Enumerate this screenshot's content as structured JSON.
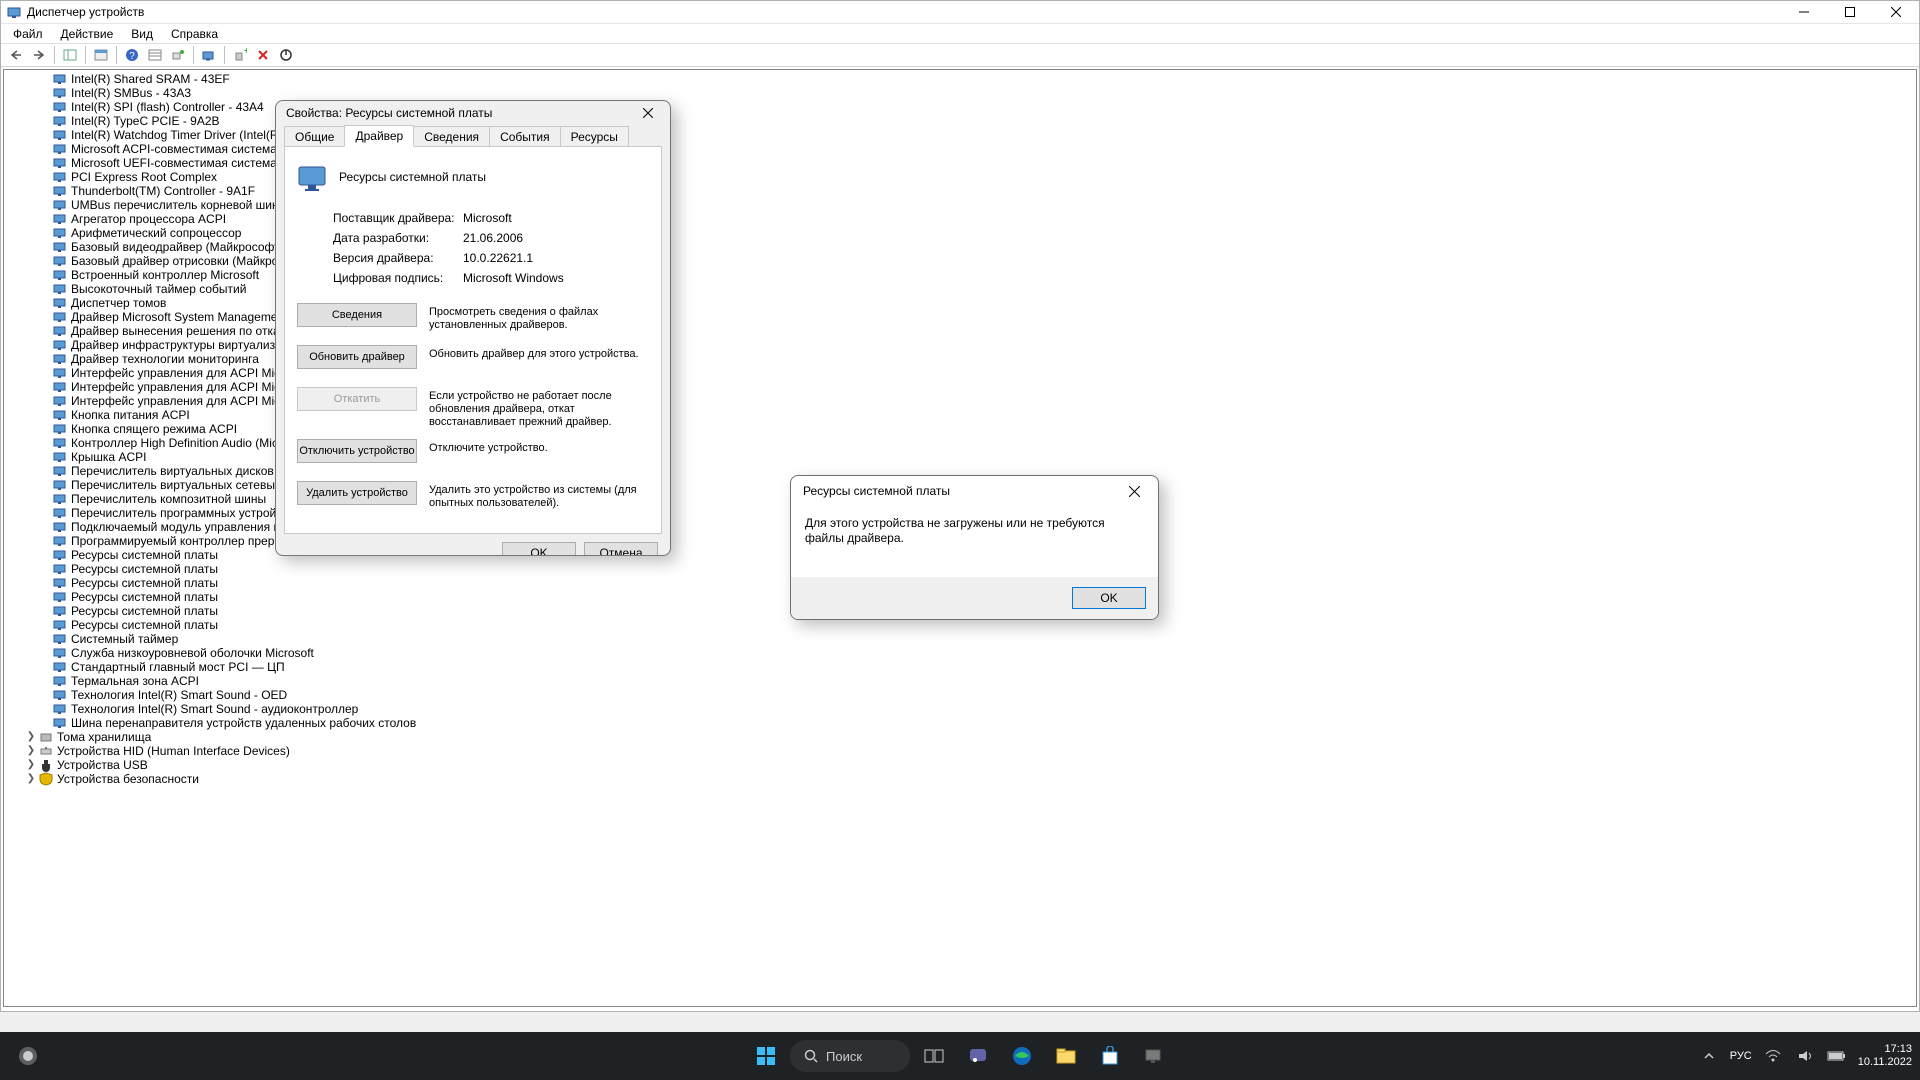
{
  "window": {
    "title": "Диспетчер устройств"
  },
  "menus": [
    "Файл",
    "Действие",
    "Вид",
    "Справка"
  ],
  "tree": {
    "devices": [
      "Intel(R) Shared SRAM - 43EF",
      "Intel(R) SMBus - 43A3",
      "Intel(R) SPI (flash) Controller - 43A4",
      "Intel(R) TypeC PCIE - 9A2B",
      "Intel(R) Watchdog Timer Driver (Intel(R) WDT)",
      "Microsoft ACPI-совместимая система",
      "Microsoft UEFI-совместимая система",
      "PCI Express Root Complex",
      "Thunderbolt(TM) Controller - 9A1F",
      "UMBus перечислитель корневой шины",
      "Агрегатор процессора ACPI",
      "Арифметический сопроцессор",
      "Базовый видеодрайвер (Майкрософт)",
      "Базовый драйвер отрисовки (Майкрософт)",
      "Встроенный контроллер Microsoft",
      "Высокоточный таймер событий",
      "Диспетчер томов",
      "Драйвер Microsoft System Management BIOS",
      "Драйвер вынесения решения по отказоустойчивости",
      "Драйвер инфраструктуры виртуализации",
      "Драйвер технологии мониторинга",
      "Интерфейс управления для ACPI Microsoft",
      "Интерфейс управления для ACPI Microsoft",
      "Интерфейс управления для ACPI Microsoft",
      "Кнопка питания ACPI",
      "Кнопка спящего режима ACPI",
      "Контроллер High Definition Audio (Microsoft)",
      "Крышка ACPI",
      "Перечислитель виртуальных дисков (Майкрософт)",
      "Перечислитель виртуальных сетевых адаптеров NDIS",
      "Перечислитель композитной шины",
      "Перечислитель программных устройств Plug and Play",
      "Подключаемый модуль управления питанием Intel(R)",
      "Программируемый контроллер прерываний",
      "Ресурсы системной платы",
      "Ресурсы системной платы",
      "Ресурсы системной платы",
      "Ресурсы системной платы",
      "Ресурсы системной платы",
      "Ресурсы системной платы",
      "Системный таймер",
      "Служба низкоуровневой оболочки Microsoft",
      "Стандартный главный мост PCI — ЦП",
      "Термальная зона ACPI",
      "Технология Intel(R) Smart Sound - OED",
      "Технология Intel(R) Smart Sound - аудиоконтроллер",
      "Шина перенаправителя устройств удаленных рабочих столов"
    ],
    "categories": [
      "Тома хранилища",
      "Устройства HID (Human Interface Devices)",
      "Устройства USB",
      "Устройства безопасности"
    ]
  },
  "dialog": {
    "title": "Свойства: Ресурсы системной платы",
    "tabs": [
      "Общие",
      "Драйвер",
      "Сведения",
      "События",
      "Ресурсы"
    ],
    "active_tab": "Драйвер",
    "device_name": "Ресурсы системной платы",
    "info": {
      "provider_label": "Поставщик драйвера:",
      "provider_value": "Microsoft",
      "date_label": "Дата разработки:",
      "date_value": "21.06.2006",
      "version_label": "Версия драйвера:",
      "version_value": "10.0.22621.1",
      "signature_label": "Цифровая подпись:",
      "signature_value": "Microsoft Windows"
    },
    "buttons": {
      "details": "Сведения",
      "details_desc": "Просмотреть сведения о файлах установленных драйверов.",
      "update": "Обновить драйвер",
      "update_desc": "Обновить драйвер для этого устройства.",
      "rollback": "Откатить",
      "rollback_desc": "Если устройство не работает после обновления драйвера, откат восстанавливает прежний драйвер.",
      "disable": "Отключить устройство",
      "disable_desc": "Отключите устройство.",
      "delete": "Удалить устройство",
      "delete_desc": "Удалить это устройство из системы (для опытных пользователей)."
    },
    "ok": "OK",
    "cancel": "Отмена"
  },
  "msgbox": {
    "title": "Ресурсы системной платы",
    "body": "Для этого устройства не загружены или не требуются файлы драйвера.",
    "ok": "OK"
  },
  "taskbar": {
    "search": "Поиск",
    "lang": "РУС",
    "time": "17:13",
    "date": "10.11.2022"
  }
}
